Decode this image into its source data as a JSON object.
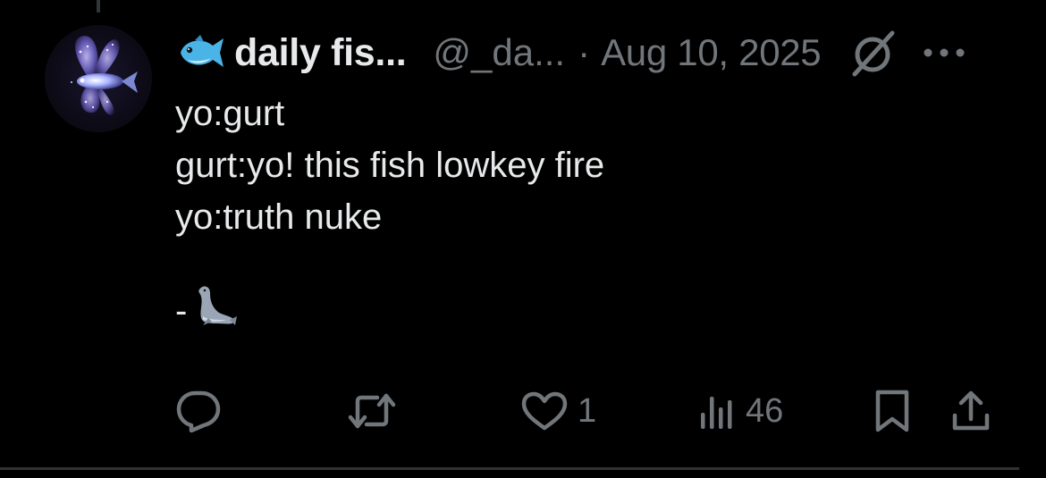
{
  "post": {
    "display_name": "daily fis...",
    "handle": "@_da...",
    "separator": "·",
    "timestamp": "Aug 10, 2025",
    "lines": [
      "yo:gurt",
      "gurt:yo! this fish lowkey fire",
      "yo:truth nuke"
    ],
    "signature_dash": "-"
  },
  "actions": {
    "reply_count": "",
    "repost_count": "",
    "like_count": "1",
    "views_count": "46"
  },
  "icons": {
    "name_emoji": "fish-emoji",
    "signature_emoji": "seal-emoji",
    "grok": "grok-icon",
    "more": "more-icon",
    "reply": "reply-icon",
    "repost": "repost-icon",
    "like": "heart-icon",
    "views": "views-icon",
    "bookmark": "bookmark-icon",
    "share": "share-icon"
  },
  "colors": {
    "background": "#000000",
    "text_primary": "#e7e9ea",
    "text_secondary": "#71767b",
    "divider": "#2f3336"
  }
}
